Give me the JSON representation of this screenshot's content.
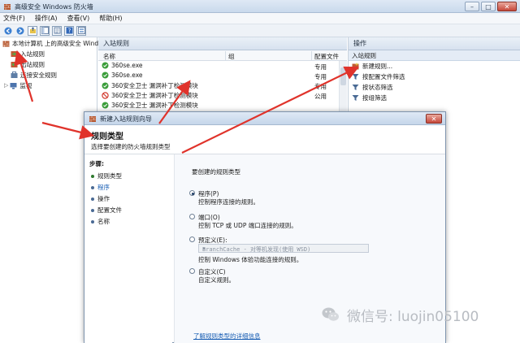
{
  "window": {
    "title": "高级安全 Windows 防火墙",
    "controls": {
      "minimize": "–",
      "maximize": "□",
      "close": "✕"
    }
  },
  "menu": [
    "文件(F)",
    "操作(A)",
    "查看(V)",
    "帮助(H)"
  ],
  "tree": {
    "root": "本地计算机 上的高级安全 Windo",
    "items": [
      "入站规则",
      "出站规则",
      "连接安全规则",
      "监视"
    ]
  },
  "list": {
    "header": "入站规则",
    "columns": {
      "name": "名称",
      "group": "组",
      "profile": "配置文件"
    },
    "rows": [
      {
        "name": "360se.exe",
        "profile": "专用",
        "status": "allow"
      },
      {
        "name": "360se.exe",
        "profile": "专用",
        "status": "allow"
      },
      {
        "name": "360安全卫士 漏洞补丁检测模块",
        "profile": "专用",
        "status": "allow"
      },
      {
        "name": "360安全卫士 漏洞补丁检测模块",
        "profile": "公用",
        "status": "block"
      },
      {
        "name": "360安全卫士 漏洞补丁检测模块",
        "profile": "",
        "status": "allow"
      }
    ]
  },
  "actions": {
    "header": "操作",
    "section": "入站规则",
    "items": [
      "新建规则...",
      "按配置文件筛选",
      "按状态筛选",
      "按组筛选"
    ]
  },
  "dialog": {
    "title": "新建入站规则向导",
    "heading": "规则类型",
    "subheading": "选择要创建的防火墙规则类型",
    "steps_label": "步骤:",
    "steps": [
      "规则类型",
      "程序",
      "操作",
      "配置文件",
      "名称"
    ],
    "question": "要创建的规则类型",
    "options": [
      {
        "name": "程序(P)",
        "desc": "控制程序连接的规则。",
        "selected": true
      },
      {
        "name": "端口(O)",
        "desc": "控制 TCP 或 UDP 端口连接的规则。",
        "selected": false
      },
      {
        "name": "预定义(E):",
        "desc": "控制 Windows 体验功能连接的规则。",
        "selected": false
      },
      {
        "name": "自定义(C)",
        "desc": "自定义规则。",
        "selected": false
      }
    ],
    "predefined_value": "BranchCache - 对等机发现(使用 WSD)",
    "learn_more": "了解规则类型的详细信息",
    "close": "✕"
  },
  "watermark": {
    "text": "微信号: luojin05100"
  },
  "colors": {
    "annotation": "#e0332b",
    "link": "#1a5fb4",
    "allow": "#3a9d3a",
    "block": "#d23a2f"
  }
}
